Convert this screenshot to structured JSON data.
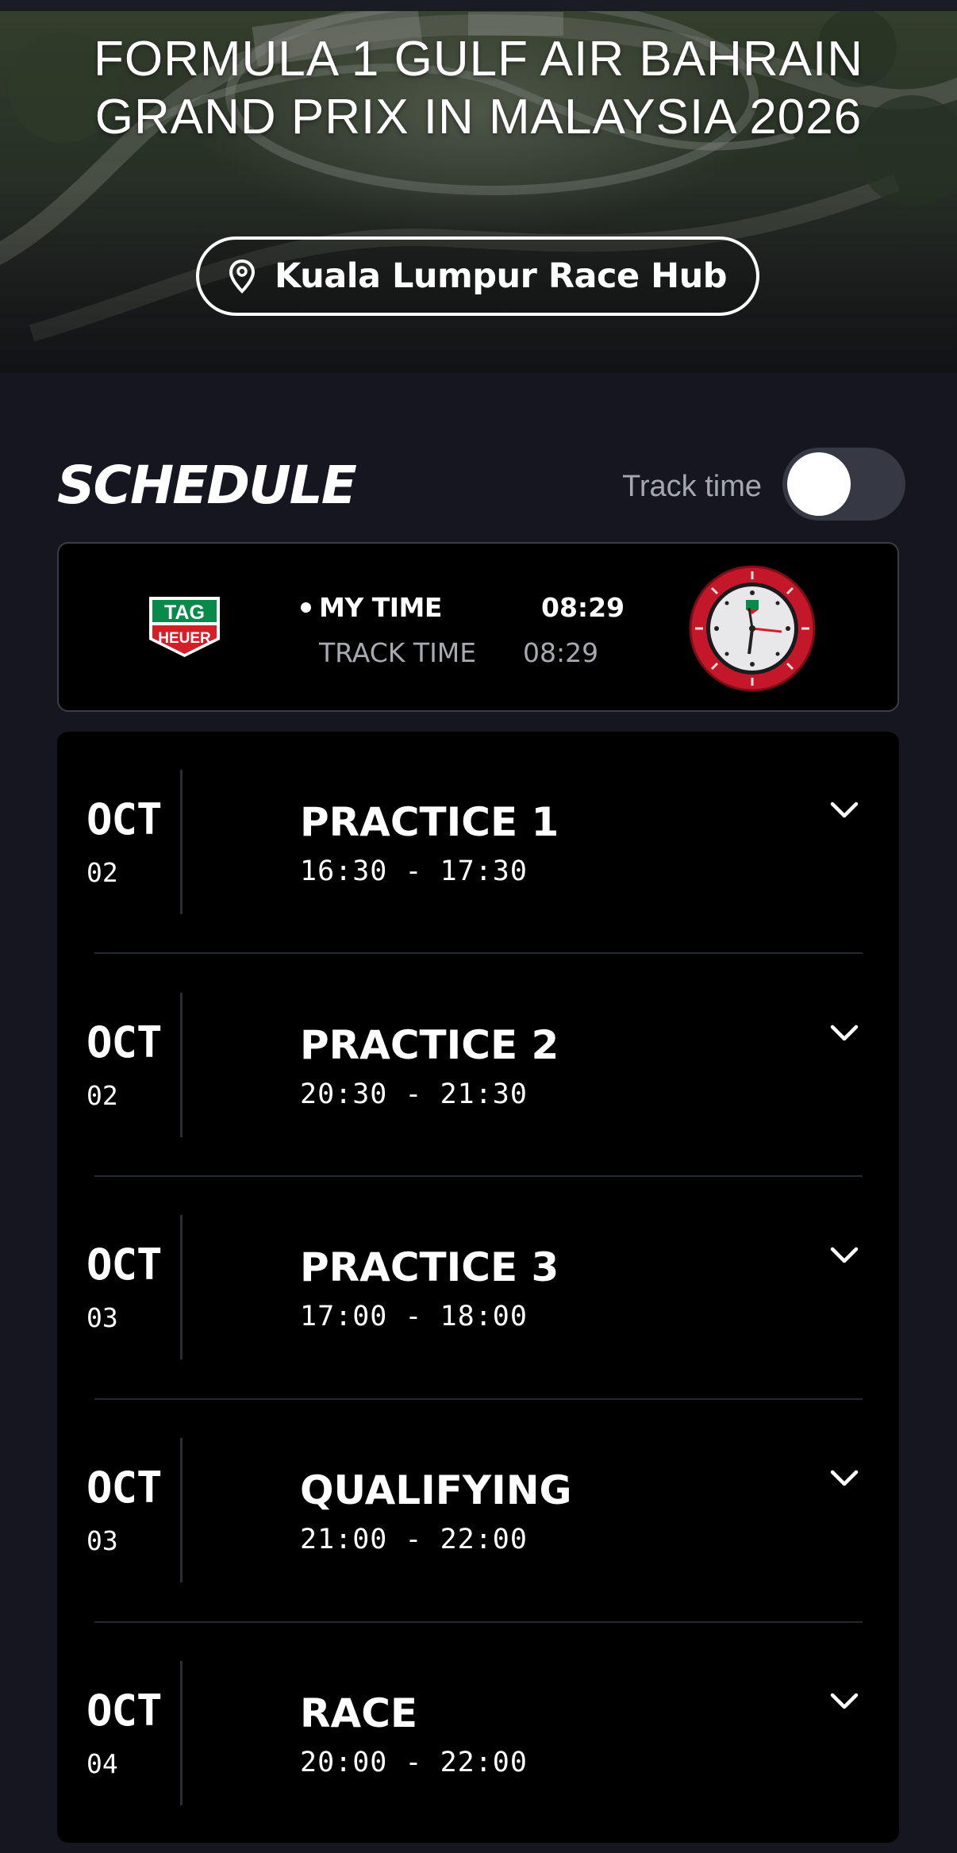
{
  "hero": {
    "title": "FORMULA 1 GULF AIR BAHRAIN GRAND PRIX IN MALAYSIA 2026",
    "location": "Kuala Lumpur Race Hub"
  },
  "schedule": {
    "title": "SCHEDULE",
    "toggle_label": "Track time",
    "toggle_on": false
  },
  "time_card": {
    "logo_text_top": "TAG",
    "logo_text_bottom": "HEUER",
    "my_time_label": "MY TIME",
    "my_time_value": "08:29",
    "track_time_label": "TRACK TIME",
    "track_time_value": "08:29"
  },
  "sessions": [
    {
      "month": "OCT",
      "day": "02",
      "name": "PRACTICE 1",
      "time": "16:30 - 17:30"
    },
    {
      "month": "OCT",
      "day": "02",
      "name": "PRACTICE 2",
      "time": "20:30 - 21:30"
    },
    {
      "month": "OCT",
      "day": "03",
      "name": "PRACTICE 3",
      "time": "17:00 - 18:00"
    },
    {
      "month": "OCT",
      "day": "03",
      "name": "QUALIFYING",
      "time": "21:00 - 22:00"
    },
    {
      "month": "OCT",
      "day": "04",
      "name": "RACE",
      "time": "20:00 - 22:00"
    }
  ],
  "colors": {
    "page_bg": "#151620",
    "card_bg": "#000000",
    "muted_text": "#a8aab2",
    "tag_green": "#0a8a4a",
    "tag_red": "#d21f2a"
  },
  "icons": {
    "location": "map-pin-icon",
    "expand": "chevron-down-icon"
  }
}
